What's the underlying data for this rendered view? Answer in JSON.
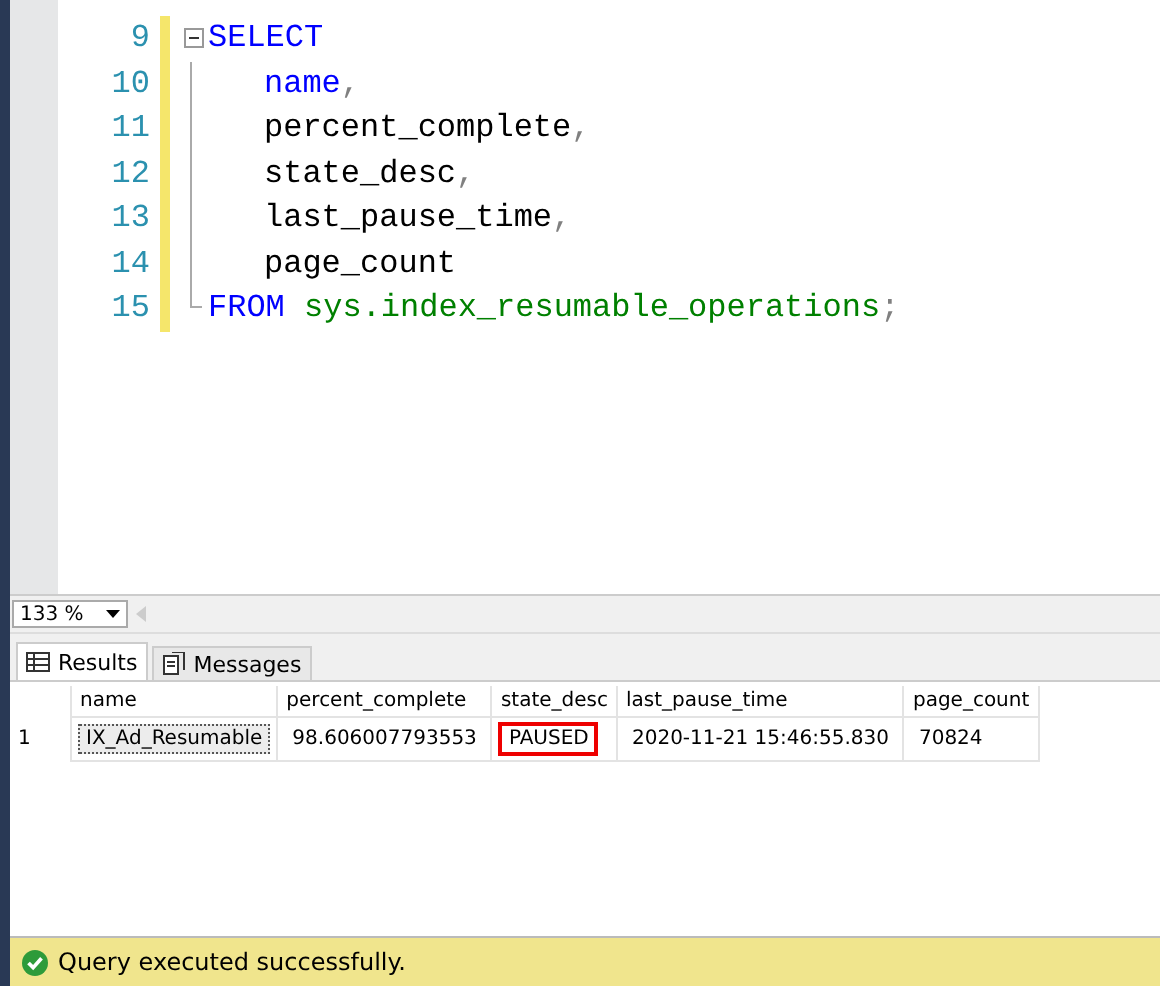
{
  "editor": {
    "lines": [
      {
        "number": "9",
        "expanded": true,
        "tokens": [
          {
            "kind": "keyword",
            "text": "SELECT"
          }
        ],
        "children": [
          {
            "number": "10",
            "tokens": [
              {
                "kind": "keyword",
                "text": "name"
              },
              {
                "kind": "punct",
                "text": ","
              }
            ]
          },
          {
            "number": "11",
            "tokens": [
              {
                "kind": "plain",
                "text": "percent_complete"
              },
              {
                "kind": "punct",
                "text": ","
              }
            ]
          },
          {
            "number": "12",
            "tokens": [
              {
                "kind": "plain",
                "text": "state_desc"
              },
              {
                "kind": "punct",
                "text": ","
              }
            ]
          },
          {
            "number": "13",
            "tokens": [
              {
                "kind": "plain",
                "text": "last_pause_time"
              },
              {
                "kind": "punct",
                "text": ","
              }
            ]
          },
          {
            "number": "14",
            "tokens": [
              {
                "kind": "plain",
                "text": "page_count"
              }
            ]
          }
        ]
      },
      {
        "number": "15",
        "tokens": [
          {
            "kind": "keyword",
            "text": "FROM"
          },
          {
            "kind": "system",
            "text": " sys.index_resumable_operations"
          },
          {
            "kind": "punct",
            "text": ";"
          }
        ]
      }
    ]
  },
  "zoom": {
    "value": "133 %"
  },
  "tabs": [
    {
      "label": "Results",
      "kind": "grid",
      "selected": true
    },
    {
      "label": "Messages",
      "kind": "messages",
      "selected": false
    }
  ],
  "table": {
    "columns": [
      "name",
      "percent_complete",
      "state_desc",
      "last_pause_time",
      "page_count"
    ],
    "rows": [
      {
        "number": "1",
        "cells": [
          {
            "text": "IX_Ad_Resumable",
            "selected": true,
            "highlighted": false
          },
          {
            "text": "98.606007793553",
            "selected": false,
            "highlighted": false
          },
          {
            "text": "PAUSED",
            "selected": false,
            "highlighted": true
          },
          {
            "text": "2020-11-21 15:46:55.830",
            "selected": false,
            "highlighted": false
          },
          {
            "text": "70824",
            "selected": false,
            "highlighted": false
          }
        ]
      }
    ]
  },
  "status_bar": {
    "text": "Query executed successfully."
  }
}
